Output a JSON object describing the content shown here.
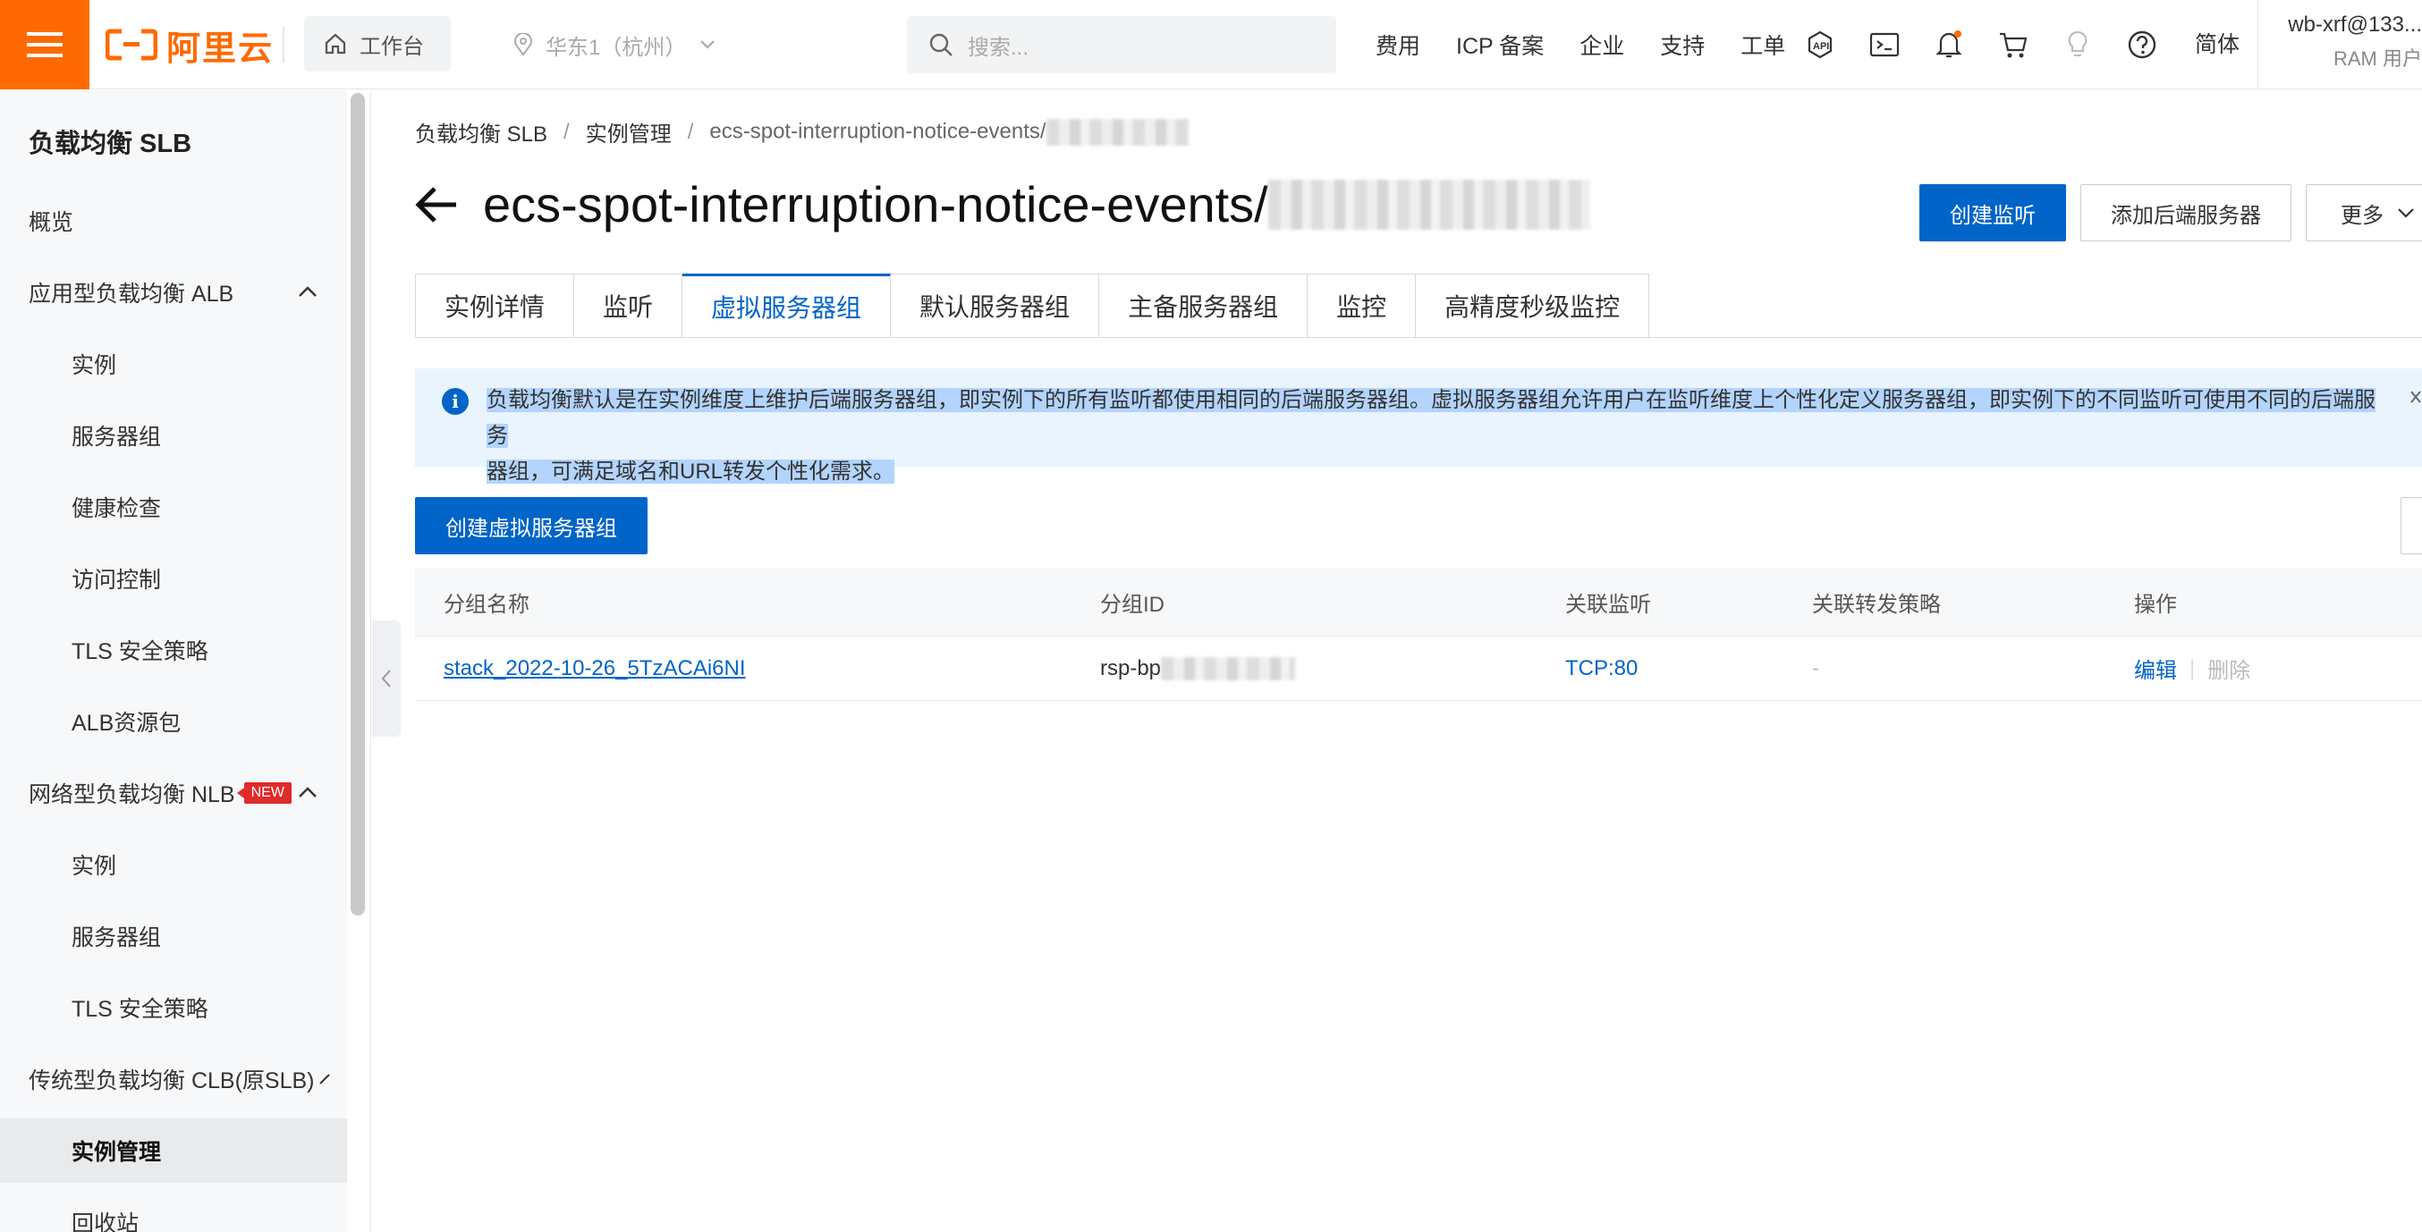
{
  "topbar": {
    "logo_text": "阿里云",
    "workbench": "工作台",
    "region": "华东1（杭州）",
    "search_placeholder": "搜索...",
    "nav": [
      "费用",
      "ICP 备案",
      "企业",
      "支持",
      "工单"
    ],
    "icons": [
      "api-icon",
      "terminal-icon",
      "bell-icon",
      "cart-icon",
      "bulb-icon",
      "help-icon"
    ],
    "lang": "简体",
    "user_name": "wb-xrf@133...",
    "user_role": "RAM 用户",
    "brand_color": "#ff6a00"
  },
  "sidebar": {
    "title": "负载均衡 SLB",
    "items": [
      {
        "label": "概览",
        "level": 1
      },
      {
        "label": "应用型负载均衡 ALB",
        "level": 1,
        "expanded": true
      },
      {
        "label": "实例",
        "level": 2
      },
      {
        "label": "服务器组",
        "level": 2
      },
      {
        "label": "健康检查",
        "level": 2
      },
      {
        "label": "访问控制",
        "level": 2
      },
      {
        "label": "TLS 安全策略",
        "level": 2
      },
      {
        "label": "ALB资源包",
        "level": 2
      },
      {
        "label": "网络型负载均衡 NLB",
        "level": 1,
        "expanded": true,
        "badge": "NEW"
      },
      {
        "label": "实例",
        "level": 2
      },
      {
        "label": "服务器组",
        "level": 2
      },
      {
        "label": "TLS 安全策略",
        "level": 2
      },
      {
        "label": "传统型负载均衡 CLB(原SLB)",
        "level": 1
      },
      {
        "label": "实例管理",
        "level": 2,
        "active": true
      },
      {
        "label": "回收站",
        "level": 2
      }
    ]
  },
  "breadcrumb": [
    "负载均衡 SLB",
    "实例管理",
    "ecs-spot-interruption-notice-events/"
  ],
  "page": {
    "title": "ecs-spot-interruption-notice-events/",
    "actions": {
      "create_listener": "创建监听",
      "add_backend": "添加后端服务器",
      "more": "更多"
    }
  },
  "tabs": [
    "实例详情",
    "监听",
    "虚拟服务器组",
    "默认服务器组",
    "主备服务器组",
    "监控",
    "高精度秒级监控"
  ],
  "active_tab": "虚拟服务器组",
  "notice": {
    "line1": "负载均衡默认是在实例维度上维护后端服务器组，即实例下的所有监听都使用相同的后端服务器组。虚拟服务器组允许用户在监听维度上个性化定义服务器组，即实例下的不同监听可使用不同的后端服务",
    "line2": "器组，可满足域名和URL转发个性化需求。"
  },
  "create_vsg_button": "创建虚拟服务器组",
  "table": {
    "columns": [
      "分组名称",
      "分组ID",
      "关联监听",
      "关联转发策略",
      "操作"
    ],
    "rows": [
      {
        "name": "stack_2022-10-26_5TzACAi6NI",
        "id": "rsp-bp",
        "listener": "TCP:80",
        "rule": "-",
        "edit": "编辑",
        "delete": "删除"
      }
    ]
  },
  "accent_color": "#0064c8"
}
